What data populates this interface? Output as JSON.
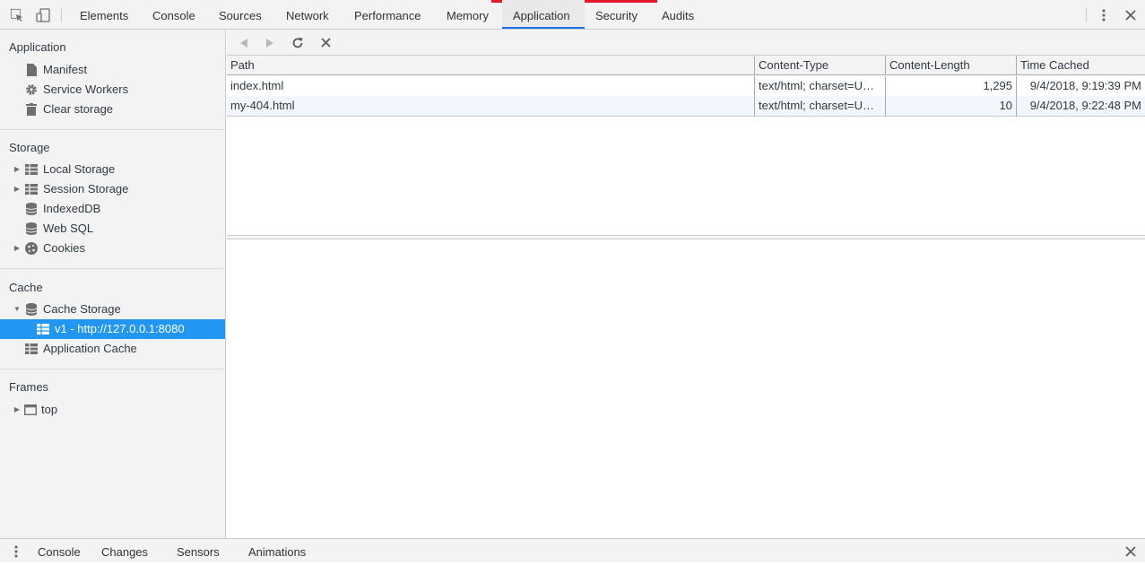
{
  "toolbar": {
    "tabs": [
      "Elements",
      "Console",
      "Sources",
      "Network",
      "Performance",
      "Memory",
      "Application",
      "Security",
      "Audits"
    ],
    "active_tab": "Application",
    "icons": {
      "inspect": "inspect-element-icon",
      "device": "device-toolbar-icon",
      "more": "kebab-menu-icon",
      "close": "close-icon"
    }
  },
  "sidebar": {
    "application": {
      "title": "Application",
      "items": [
        {
          "label": "Manifest",
          "icon": "file-icon"
        },
        {
          "label": "Service Workers",
          "icon": "gear-icon"
        },
        {
          "label": "Clear storage",
          "icon": "trash-icon"
        }
      ]
    },
    "storage": {
      "title": "Storage",
      "items": [
        {
          "label": "Local Storage",
          "icon": "table-icon",
          "expandable": true
        },
        {
          "label": "Session Storage",
          "icon": "table-icon",
          "expandable": true
        },
        {
          "label": "IndexedDB",
          "icon": "database-icon"
        },
        {
          "label": "Web SQL",
          "icon": "database-icon"
        },
        {
          "label": "Cookies",
          "icon": "cookie-icon",
          "expandable": true
        }
      ]
    },
    "cache": {
      "title": "Cache",
      "items": [
        {
          "label": "Cache Storage",
          "icon": "database-icon",
          "expanded": true
        },
        {
          "label": "v1 - http://127.0.0.1:8080",
          "icon": "table-icon",
          "selected": true
        },
        {
          "label": "Application Cache",
          "icon": "table-icon"
        }
      ]
    },
    "frames": {
      "title": "Frames",
      "items": [
        {
          "label": "top",
          "icon": "frame-icon",
          "expandable": true
        }
      ]
    }
  },
  "cache_view": {
    "toolbar_icons": [
      "back-icon",
      "forward-icon",
      "refresh-icon",
      "delete-icon"
    ],
    "columns": [
      "Path",
      "Content-Type",
      "Content-Length",
      "Time Cached"
    ],
    "rows": [
      {
        "path": "index.html",
        "content_type": "text/html; charset=U…",
        "content_length": "1,295",
        "time_cached": "9/4/2018, 9:19:39 PM"
      },
      {
        "path": "my-404.html",
        "content_type": "text/html; charset=U…",
        "content_length": "10",
        "time_cached": "9/4/2018, 9:22:48 PM"
      }
    ]
  },
  "drawer": {
    "tabs": [
      "Console",
      "Changes",
      "Sensors",
      "Animations"
    ],
    "active_tab": "Console"
  },
  "colors": {
    "accent": "#1a73e8",
    "selection": "#2196f3",
    "brand_mark": "#e8172c"
  }
}
